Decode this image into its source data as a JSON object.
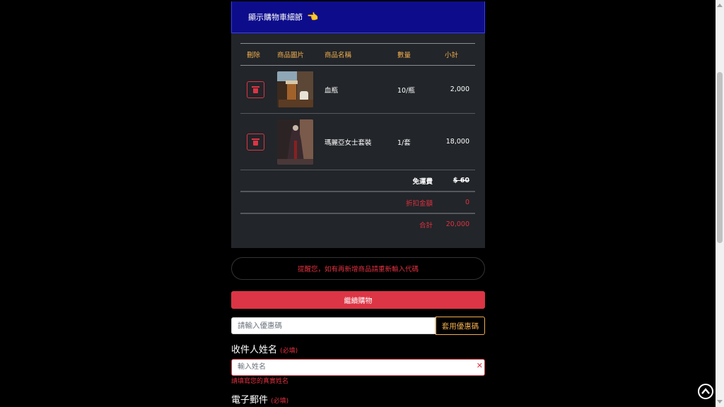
{
  "cart_header": {
    "title": "顯示購物車細節",
    "icon": "pointing-hand-icon",
    "hand_glyph": "👈"
  },
  "table": {
    "headers": {
      "delete": "刪除",
      "image": "商品圖片",
      "name": "商品名稱",
      "qty": "數量",
      "subtotal": "小計"
    },
    "rows": [
      {
        "name": "血瓶",
        "qty": "10/瓶",
        "subtotal": "2,000"
      },
      {
        "name": "瑪麗亞女士套裝",
        "qty": "1/套",
        "subtotal": "18,000"
      }
    ],
    "shipping": {
      "label": "免運費",
      "value": "$ 60"
    },
    "discount": {
      "label": "折扣金額",
      "value": "0"
    },
    "total": {
      "label": "合計",
      "value": "20,000"
    }
  },
  "notice": "提醒您，如有再新增商品請重新輸入代碼",
  "continue_button": "繼續購物",
  "coupon": {
    "placeholder": "請輸入優惠碼",
    "button": "套用優惠碼"
  },
  "recipient": {
    "label": "收件人姓名",
    "required": "(必填)",
    "placeholder": "輸入姓名",
    "error": "請填寫您的真實姓名",
    "invalid_mark": "✕"
  },
  "email": {
    "label": "電子郵件",
    "required": "(必填)"
  },
  "colors": {
    "header_bg": "#0d0d8c",
    "danger": "#dc3545",
    "accent": "#f0ad4e",
    "panel_bg": "#222529"
  }
}
